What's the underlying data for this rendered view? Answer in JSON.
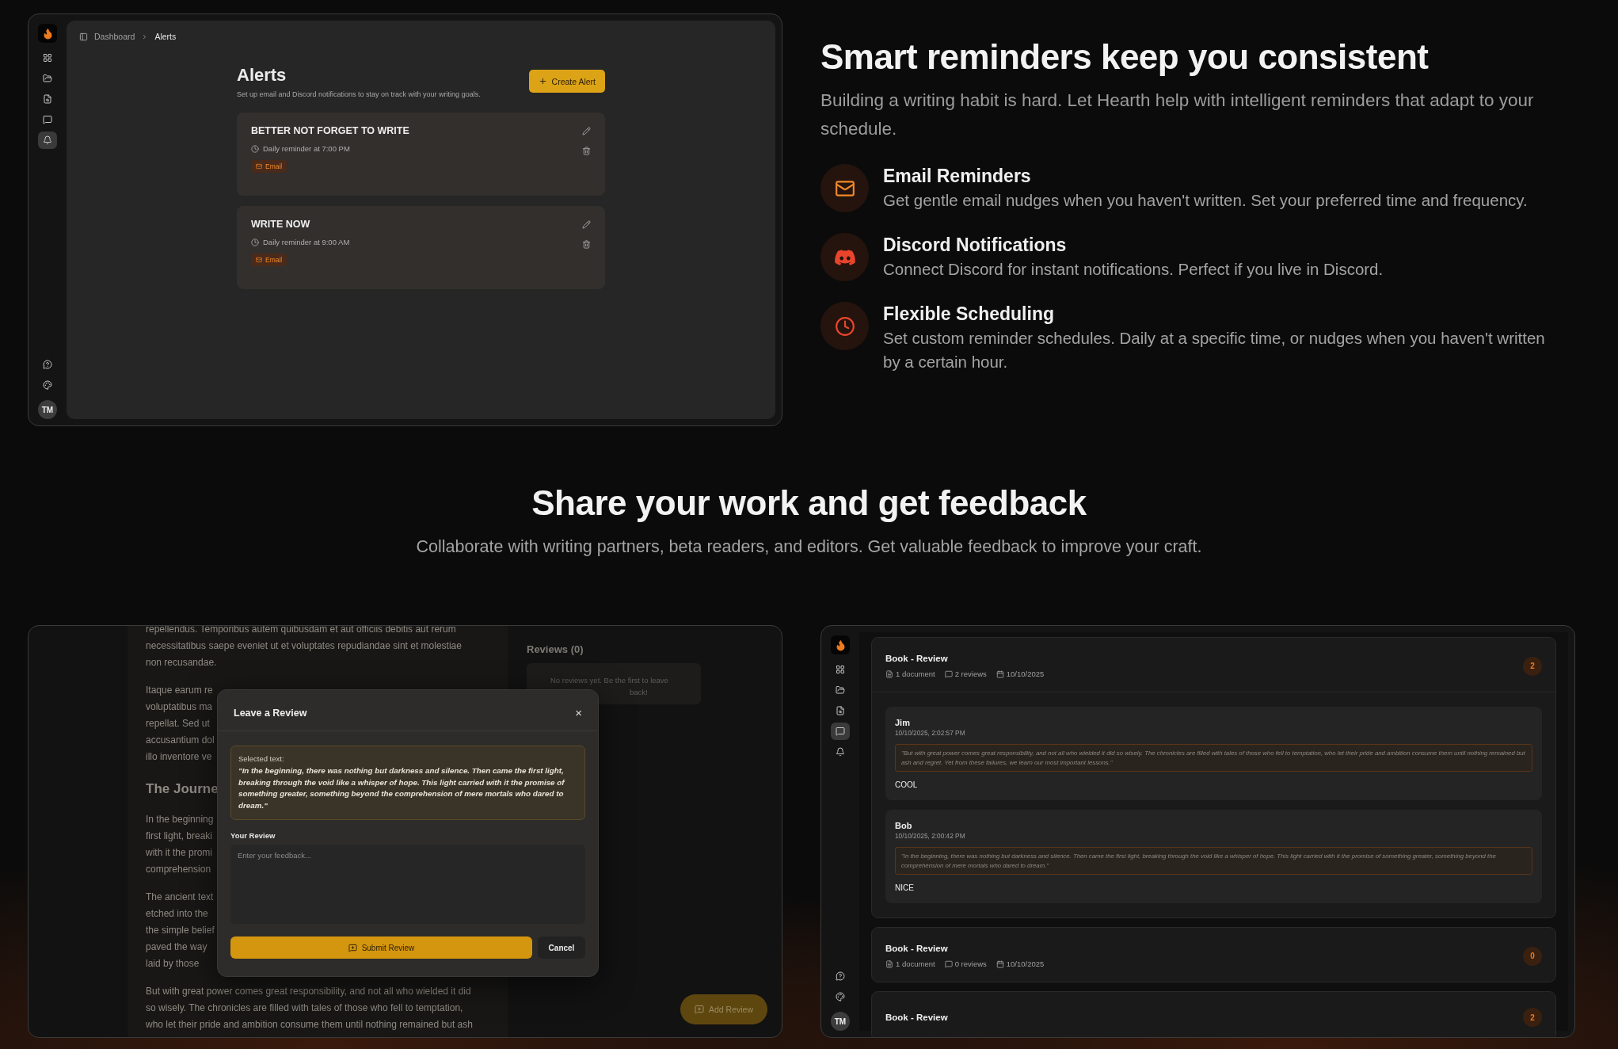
{
  "alerts_demo": {
    "sidebar": {
      "items": [
        {
          "kind": "grid",
          "selected": false
        },
        {
          "kind": "folder",
          "selected": false
        },
        {
          "kind": "file",
          "selected": false
        },
        {
          "kind": "message",
          "selected": false
        },
        {
          "kind": "bell",
          "selected": true
        }
      ],
      "bottom_items": [
        {
          "kind": "help"
        },
        {
          "kind": "palette"
        }
      ],
      "avatar": "TM"
    },
    "breadcrumb": [
      "Dashboard",
      "Alerts"
    ],
    "title": "Alerts",
    "subtitle": "Set up email and Discord notifications to stay on track with your writing goals.",
    "create_button": "Create Alert",
    "alerts": [
      {
        "title": "BETTER NOT FORGET TO WRITE",
        "schedule": "Daily reminder at 7:00 PM",
        "channel": "Email"
      },
      {
        "title": "WRITE NOW",
        "schedule": "Daily reminder at 9:00 AM",
        "channel": "Email"
      }
    ]
  },
  "reminders": {
    "title": "Smart reminders keep you consistent",
    "subtitle": "Building a writing habit is hard. Let Hearth help with intelligent reminders that adapt to your schedule.",
    "features": [
      {
        "kind": "email",
        "title": "Email Reminders",
        "text": "Get gentle email nudges when you haven't written. Set your preferred time and frequency."
      },
      {
        "kind": "discord",
        "title": "Discord Notifications",
        "text": "Connect Discord for instant notifications. Perfect if you live in Discord."
      },
      {
        "kind": "clock",
        "title": "Flexible Scheduling",
        "text": "Set custom reminder schedules. Daily at a specific time, or nudges when you haven't written by a certain hour."
      }
    ]
  },
  "share": {
    "title": "Share your work and get feedback",
    "subtitle": "Collaborate with writing partners, beta readers, and editors. Get valuable feedback to improve your craft."
  },
  "review_demo": {
    "document": [
      {
        "kind": "text",
        "lines": [
          "repellendus. Temporibus autem quibusdam et aut officiis debitis aut rerum",
          "necessitatibus saepe eveniet ut et voluptates repudiandae sint et molestiae",
          "non recusandae."
        ]
      },
      {
        "kind": "text",
        "lines": [
          "Itaque earum re",
          "voluptatibus ma",
          "repellat. Sed ut",
          "accusantium dol",
          "illo inventore ve"
        ]
      },
      {
        "kind": "heading",
        "lines": [
          "The Journe"
        ]
      },
      {
        "kind": "text",
        "lines": [
          "In the beginning",
          "first light, breaki",
          "with it the promi",
          "comprehension"
        ]
      },
      {
        "kind": "text",
        "lines": [
          "The ancient text",
          "etched into the",
          "the simple belief",
          "paved the way",
          "laid by those"
        ]
      },
      {
        "kind": "text",
        "lines": [
          "But with great power comes great responsibility, and not all who wielded it did",
          "so wisely. The chronicles are filled with tales of those who fell to temptation,",
          "who let their pride and ambition consume them until nothing remained but ash"
        ]
      }
    ],
    "reviews_title": "Reviews (0)",
    "empty_lines": [
      "No reviews yet. Be the first to leave",
      "back!"
    ],
    "modal": {
      "title": "Leave a Review",
      "close": "×",
      "selected_label": "Selected text:",
      "selected_text": "\"In the beginning, there was nothing but darkness and silence. Then came the first light, breaking through the void like a whisper of hope. This light carried with it the promise of something greater, something beyond the comprehension of mere mortals who dared to dream.\"",
      "review_label": "Your Review",
      "placeholder": "Enter your feedback...",
      "submit": "Submit Review",
      "cancel": "Cancel"
    },
    "add_review": "Add Review"
  },
  "reviews_demo": {
    "sidebar": {
      "items": [
        {
          "kind": "grid",
          "selected": false
        },
        {
          "kind": "folder",
          "selected": false
        },
        {
          "kind": "file",
          "selected": false
        },
        {
          "kind": "message",
          "selected": true
        },
        {
          "kind": "bell",
          "selected": false
        }
      ],
      "bottom_items": [
        {
          "kind": "help"
        },
        {
          "kind": "palette"
        }
      ],
      "avatar": "TM"
    },
    "groups": [
      {
        "title": "Book - Review",
        "meta": [
          {
            "kind": "document",
            "text": "1 document"
          },
          {
            "kind": "reviews",
            "text": "2 reviews"
          },
          {
            "kind": "date",
            "text": "10/10/2025"
          }
        ],
        "count": "2",
        "reviews": [
          {
            "name": "Jim",
            "date": "10/10/2025, 2:02:57 PM",
            "quote": "\"But with great power comes great responsibility, and not all who wielded it did so wisely. The chronicles are filled with tales of those who fell to temptation, who let their pride and ambition consume them until nothing remained but ash and regret. Yet from these failures, we learn our most important lessons.\"",
            "comment": "COOL"
          },
          {
            "name": "Bob",
            "date": "10/10/2025, 2:00:42 PM",
            "quote": "\"In the beginning, there was nothing but darkness and silence. Then came the first light, breaking through the void like a whisper of hope. This light carried with it the promise of something greater, something beyond the comprehension of mere mortals who dared to dream.\"",
            "comment": "NICE"
          }
        ]
      },
      {
        "title": "Book - Review",
        "meta": [
          {
            "kind": "document",
            "text": "1 document"
          },
          {
            "kind": "reviews",
            "text": "0 reviews"
          },
          {
            "kind": "date",
            "text": "10/10/2025"
          }
        ],
        "count": "0"
      },
      {
        "title": "Book - Review",
        "count": "2"
      }
    ]
  }
}
